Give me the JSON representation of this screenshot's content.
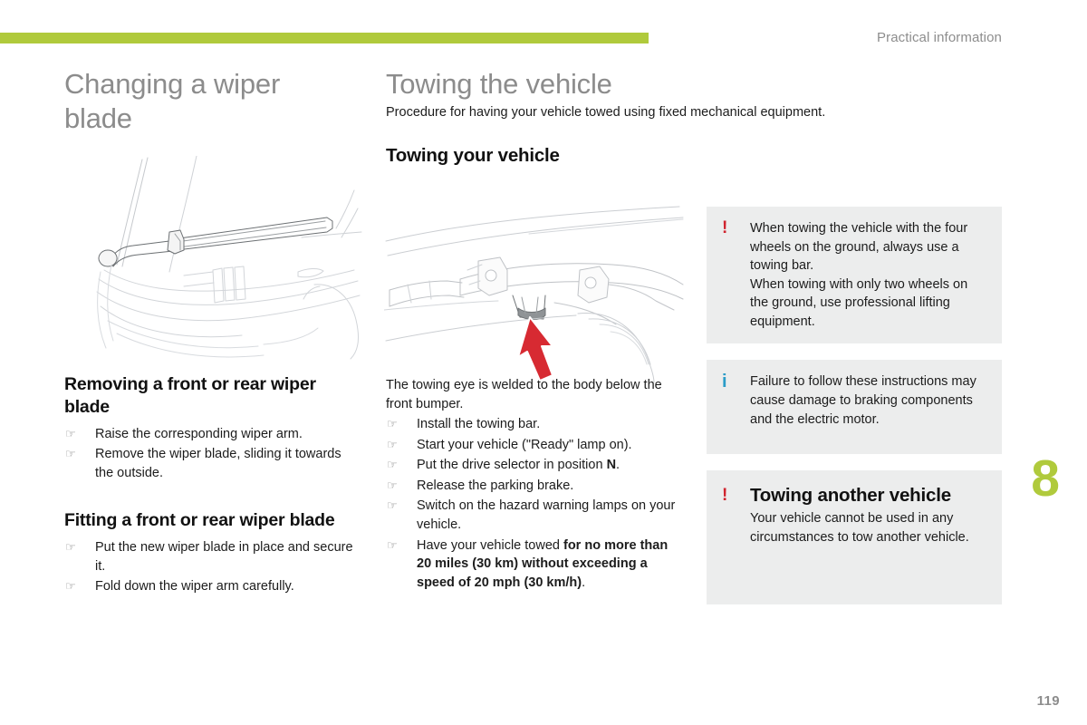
{
  "header": {
    "section_label": "Practical information",
    "accent_color": "#b0ca3c"
  },
  "left_column": {
    "title": "Changing a wiper blade",
    "illustration_name": "wiper-arm-raised-on-windscreen",
    "blocks": [
      {
        "title": "Removing a front or rear wiper blade",
        "items": [
          "Raise the corresponding wiper arm.",
          "Remove the wiper blade, sliding it towards the outside."
        ]
      },
      {
        "title": "Fitting a front or rear wiper blade",
        "items": [
          "Put the new wiper blade in place and secure it.",
          "Fold down the wiper arm carefully."
        ]
      }
    ]
  },
  "middle_column": {
    "title": "Towing the vehicle",
    "intro": "Procedure for having your vehicle towed using fixed mechanical equipment.",
    "section_title": "Towing your vehicle",
    "illustration_name": "vehicle-underbody-towing-eye-with-red-arrow",
    "paragraph": "The towing eye is welded to the body below the front bumper.",
    "items": [
      "Install the towing bar.",
      "Start your vehicle (\"Ready\" lamp on).",
      "Put the drive selector in position N.",
      "Release the parking brake.",
      "Switch on the hazard warning lamps on your vehicle.",
      "Have your vehicle towed for no more than 20 miles (30 km) without exceeding a speed of 20 mph (30 km/h)."
    ],
    "items_html": [
      "Install the towing bar.",
      "Start your vehicle (\"Ready\" lamp on).",
      "Put the drive selector in position <b>N</b>.",
      "Release the parking brake.",
      "Switch on the hazard warning lamps on your vehicle.",
      "Have your vehicle towed <b>for no more than 20 miles (30 km) without exceeding a speed of 20 mph (30 km/h)</b>."
    ],
    "bullet_glyph": "☞"
  },
  "callouts": [
    {
      "icon": "warning-exclamation-icon",
      "glyph": "!",
      "color": "#d0242e",
      "heading": "",
      "text": "When towing the vehicle with the four wheels on the ground, always use a towing bar. When towing with only two wheels on the ground, use professional lifting equipment.",
      "lines": [
        "When towing the vehicle with the four wheels on the ground, always use a towing bar.",
        "When towing with only two wheels on the ground, use professional lifting equipment."
      ]
    },
    {
      "icon": "information-i-icon",
      "glyph": "i",
      "color": "#2b9cc8",
      "heading": "",
      "text": "Failure to follow these instructions may cause damage to braking components and the electric motor."
    },
    {
      "icon": "warning-exclamation-icon",
      "glyph": "!",
      "color": "#d0242e",
      "heading": "Towing another vehicle",
      "text": "Your vehicle cannot be used in any circumstances to tow another vehicle."
    }
  ],
  "chapter_number": "8",
  "page_number": "119"
}
